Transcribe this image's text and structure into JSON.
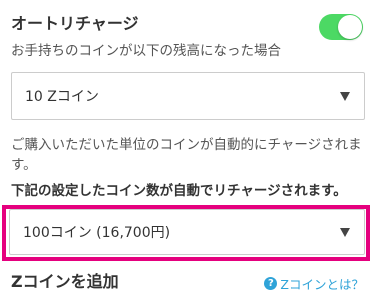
{
  "auto_charge": {
    "title": "オートリチャージ",
    "toggle_on": true,
    "toggle_color": "#4cd964",
    "threshold_description": "お手持ちのコインが以下の残高になった場合",
    "threshold_select": {
      "value": "10 Zコイン"
    },
    "unit_description": "ご購入いただいた単位のコインが自動的にチャージされます。",
    "amount_description": "下記の設定したコイン数が自動でリチャージされます。",
    "amount_select": {
      "value": "100コイン (16,700円)",
      "highlight_color": "#e5007e"
    }
  },
  "add_coins": {
    "title": "Zコインを追加",
    "help_icon": "question-circle-icon",
    "help_link": "Zコインとは？",
    "link_color": "#2fa3d8"
  }
}
